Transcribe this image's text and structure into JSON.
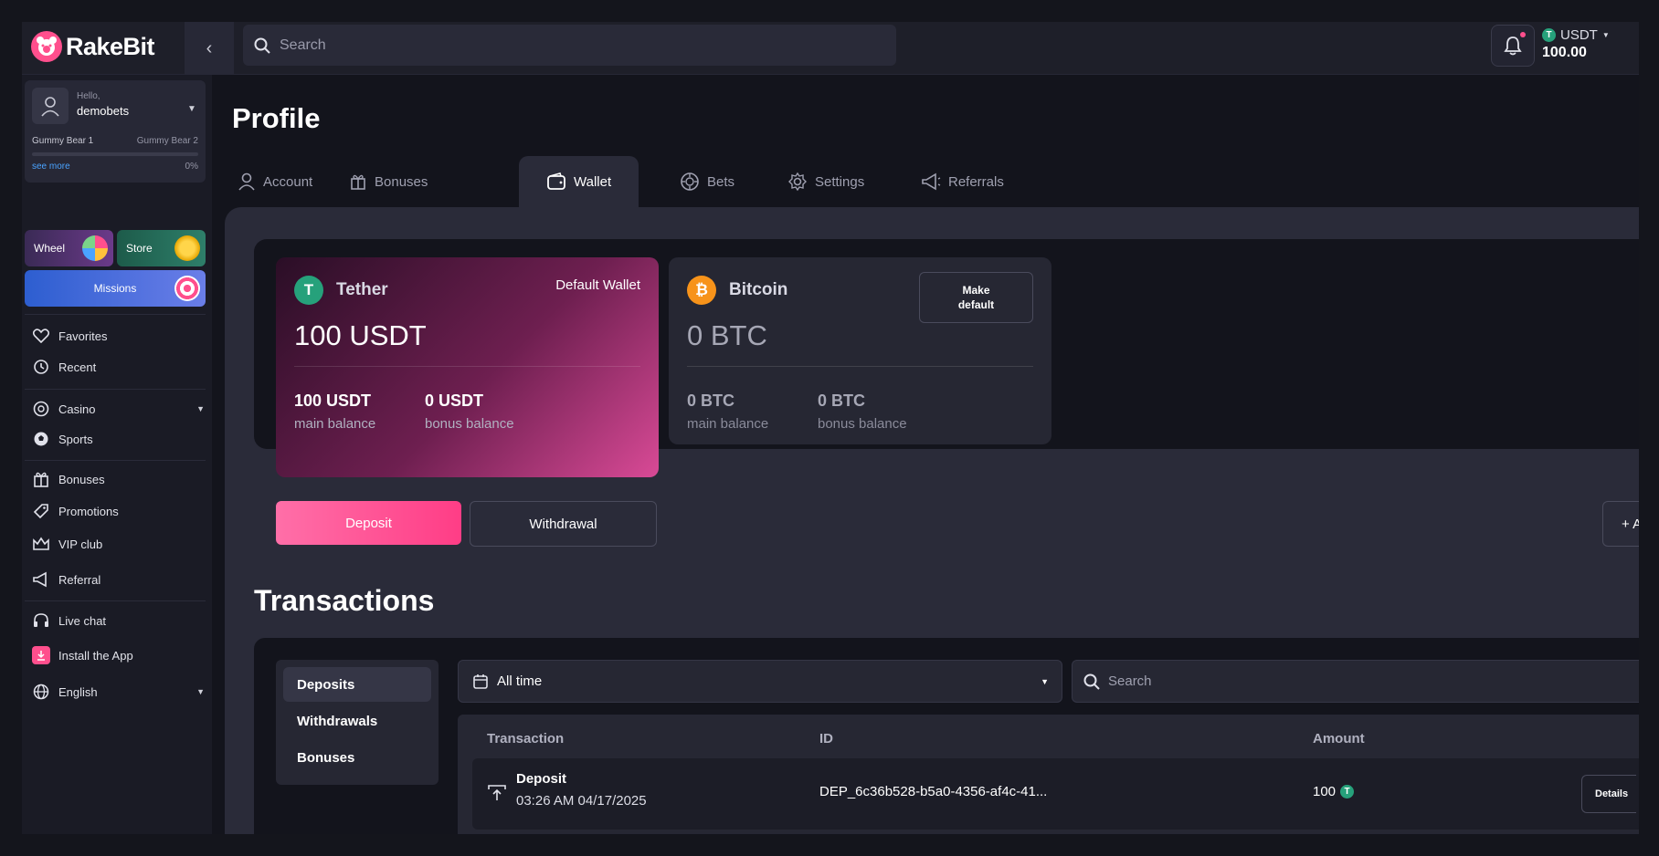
{
  "app": {
    "name": "RakeBit"
  },
  "header": {
    "search_placeholder": "Search",
    "currency": "USDT",
    "balance": "100.00"
  },
  "user": {
    "greeting": "Hello,",
    "username": "demobets",
    "level_current": "Gummy Bear 1",
    "level_next": "Gummy Bear 2",
    "see_more": "see more",
    "progress_pct": "0%"
  },
  "promos": {
    "wheel": "Wheel",
    "store": "Store",
    "missions": "Missions"
  },
  "nav": {
    "favorites": "Favorites",
    "recent": "Recent",
    "casino": "Casino",
    "sports": "Sports",
    "bonuses": "Bonuses",
    "promotions": "Promotions",
    "vip": "VIP club",
    "referral": "Referral",
    "livechat": "Live chat",
    "install": "Install the App",
    "language": "English"
  },
  "page": {
    "title": "Profile"
  },
  "tabs": [
    "Account",
    "Bonuses",
    "Wallet",
    "Bets",
    "Settings",
    "Referrals"
  ],
  "wallets": {
    "tether": {
      "name": "Tether",
      "badge": "Default Wallet",
      "balance": "100 USDT",
      "main_value": "100 USDT",
      "main_label": "main balance",
      "bonus_value": "0 USDT",
      "bonus_label": "bonus balance"
    },
    "bitcoin": {
      "name": "Bitcoin",
      "make_default": "Make default",
      "balance": "0 BTC",
      "main_value": "0 BTC",
      "main_label": "main balance",
      "bonus_value": "0 BTC",
      "bonus_label": "bonus balance"
    }
  },
  "actions": {
    "deposit": "Deposit",
    "withdrawal": "Withdrawal",
    "add": "+ Add"
  },
  "transactions": {
    "title": "Transactions",
    "tabs": [
      "Deposits",
      "Withdrawals",
      "Bonuses"
    ],
    "filter": "All time",
    "search_placeholder": "Search",
    "columns": [
      "Transaction",
      "ID",
      "Amount"
    ],
    "rows": [
      {
        "type": "Deposit",
        "date": "03:26 AM 04/17/2025",
        "id": "DEP_6c36b528-b5a0-4356-af4c-41...",
        "amount": "100",
        "details": "Details"
      }
    ]
  },
  "colors": {
    "accent": "#ff4f8d",
    "tether": "#26a17b",
    "bitcoin": "#f7931a"
  }
}
